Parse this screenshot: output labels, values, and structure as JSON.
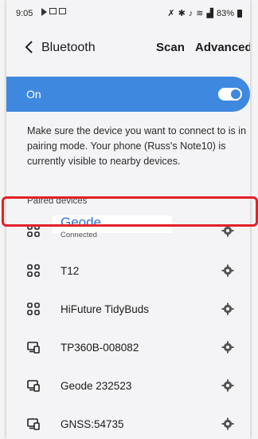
{
  "status_bar": {
    "time": "9:05",
    "battery": "83%",
    "icons": [
      "play-icon",
      "image-icon",
      "gallery-icon",
      "nfc-icon",
      "bluetooth-icon",
      "mute-icon",
      "wifi-icon",
      "signal-icon",
      "battery-icon"
    ]
  },
  "header": {
    "title": "Bluetooth",
    "scan": "Scan",
    "advanced": "Advanced"
  },
  "bluetooth_toggle": {
    "label": "On",
    "state": true,
    "accent_color": "#3e89df"
  },
  "info_text": "Make sure the device you want to connect to is in pairing mode. Your phone (Russ's Note10) is currently visible to nearby devices.",
  "section_title": "Paired devices",
  "devices": [
    {
      "name": "Geode",
      "status": "Connected",
      "icon": "earbuds-icon"
    },
    {
      "name": "T12",
      "icon": "earbuds-icon"
    },
    {
      "name": "HiFuture TidyBuds",
      "icon": "earbuds-icon"
    },
    {
      "name": "TP360B-008082",
      "icon": "computer-icon"
    },
    {
      "name": "Geode 232523",
      "icon": "computer-icon"
    },
    {
      "name": "GNSS:54735",
      "icon": "computer-icon"
    }
  ],
  "highlight_color": "#e4202a"
}
